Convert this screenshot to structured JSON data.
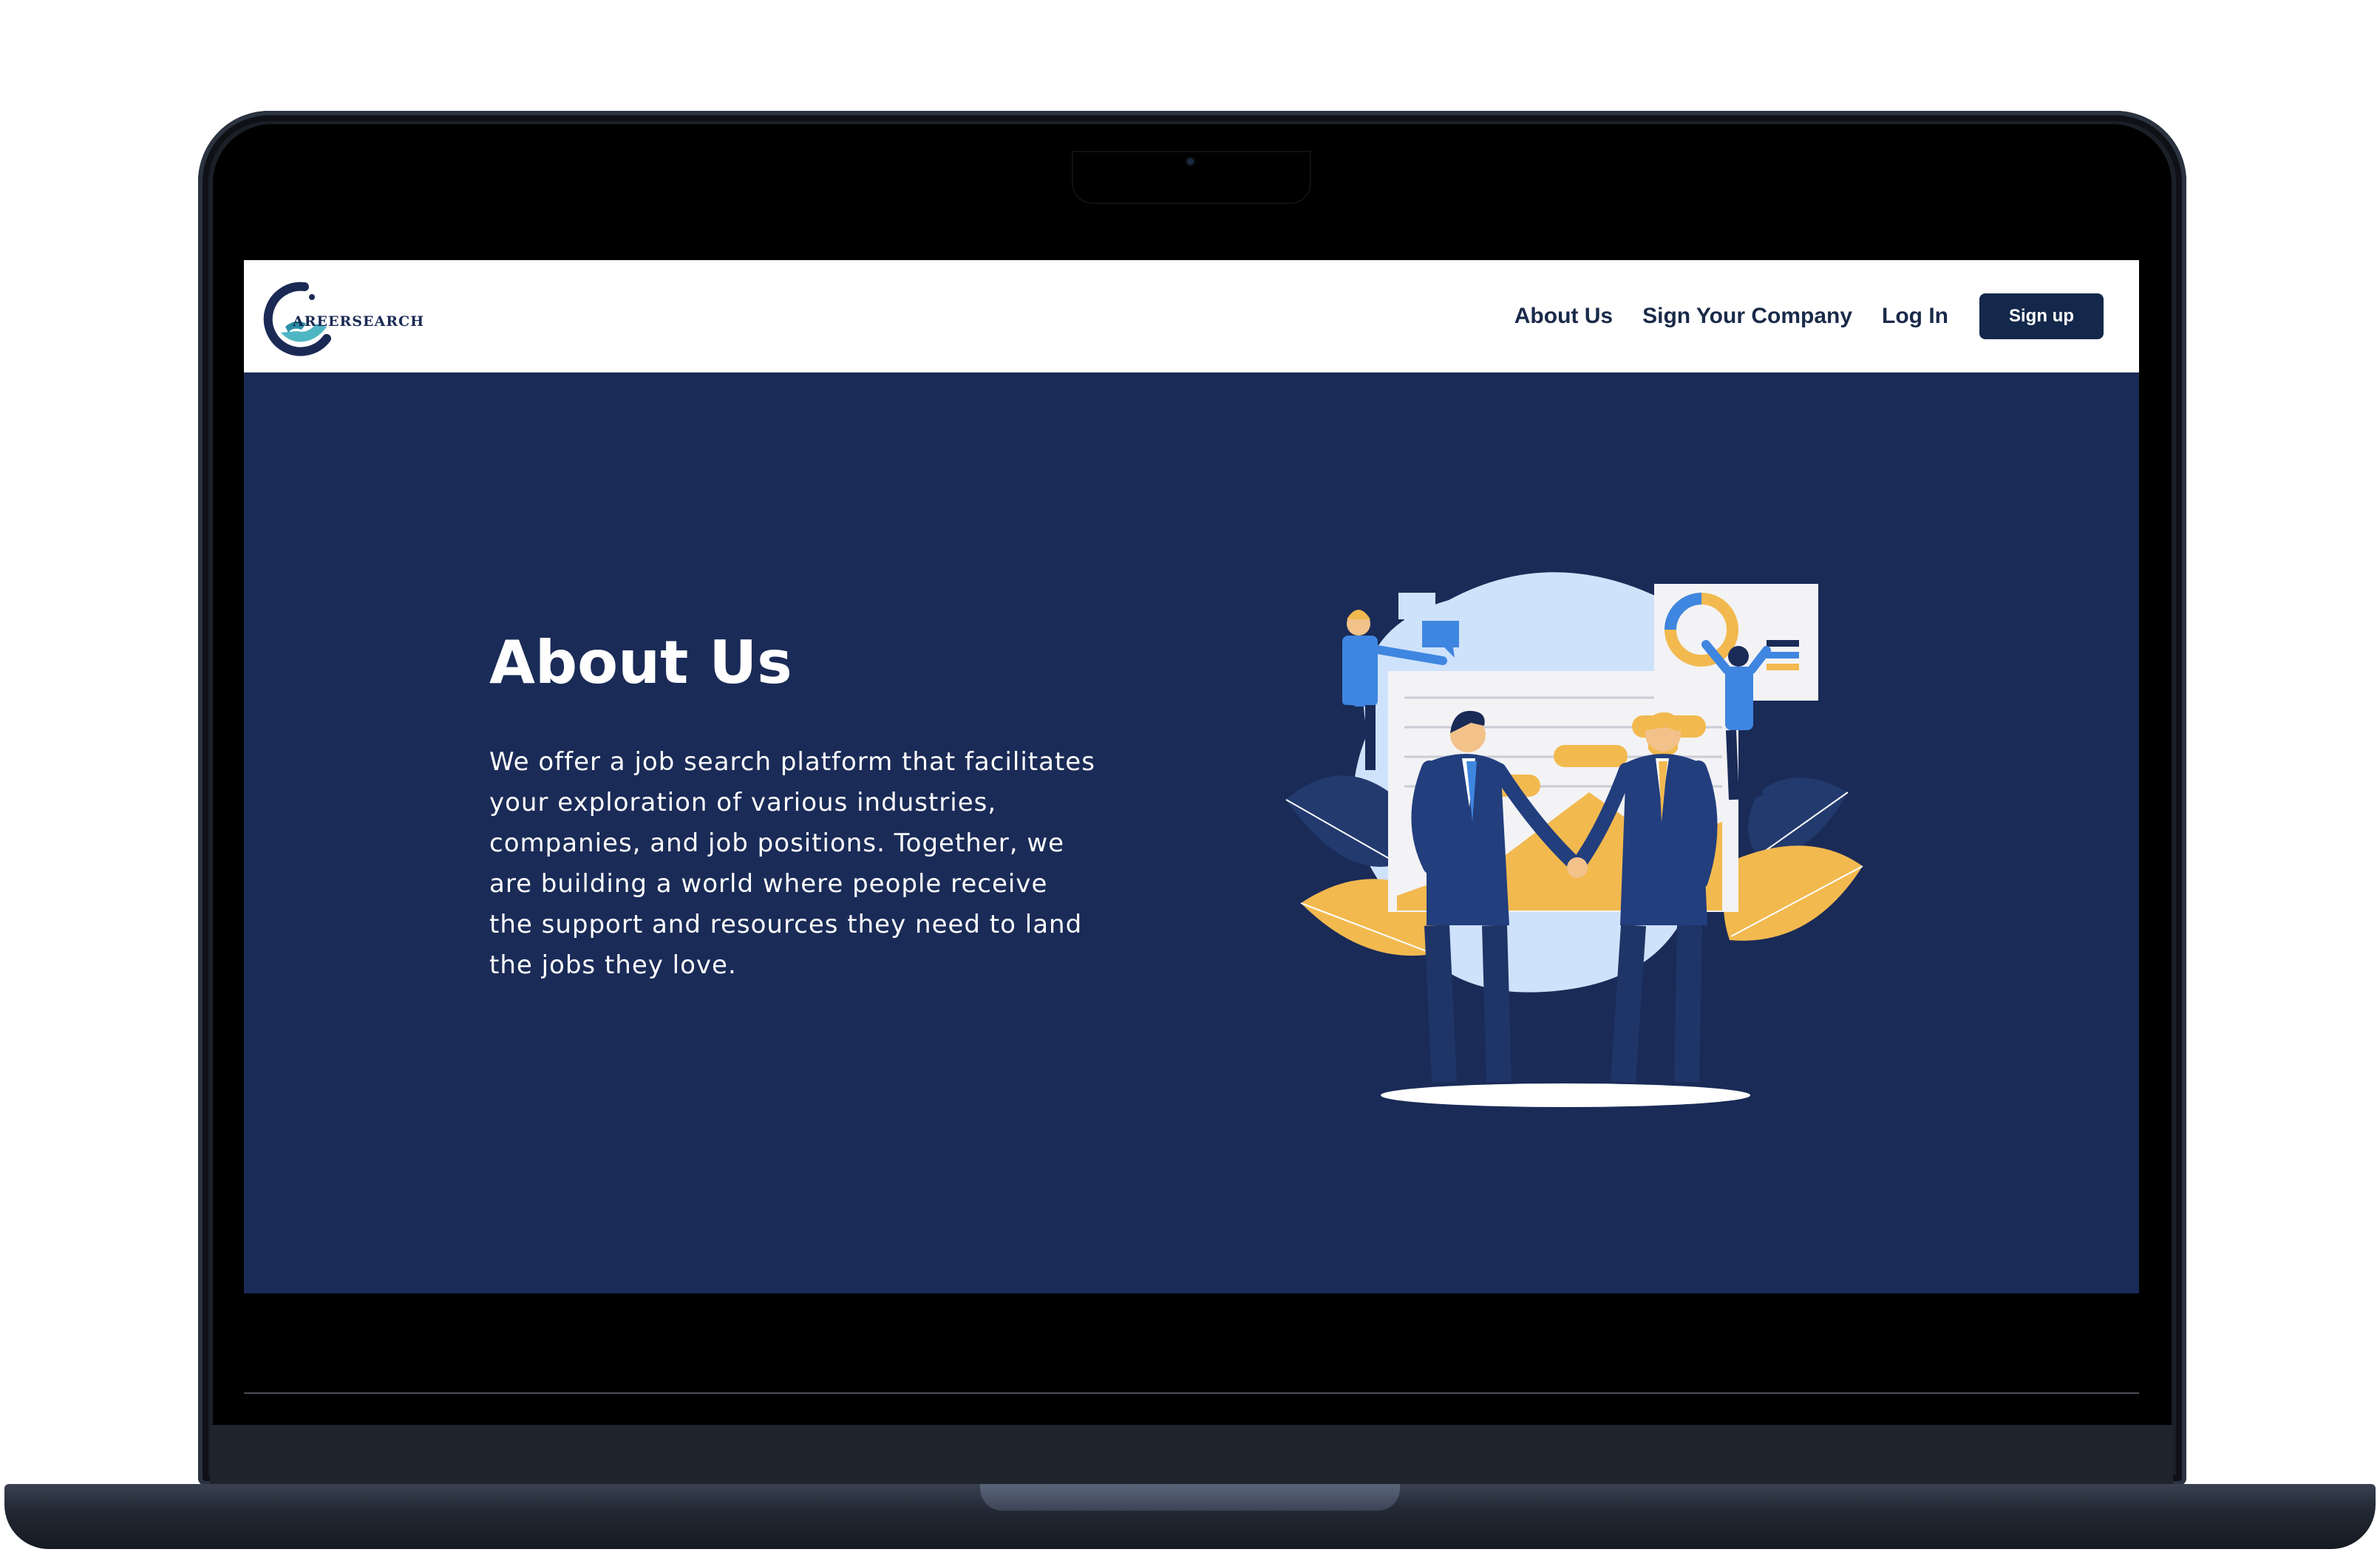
{
  "brand": {
    "logo_text": "AREERSEARCH"
  },
  "nav": {
    "links": [
      {
        "label": "About Us"
      },
      {
        "label": "Sign Your Company"
      },
      {
        "label": "Log In"
      }
    ],
    "signup_label": "Sign up"
  },
  "hero": {
    "title": "About Us",
    "description": "We offer a job search platform that facilitates your exploration of various industries, companies, and job positions. Together, we are building a world where people receive the support and resources they need to land the jobs they love."
  },
  "colors": {
    "navy": "#1a2b57",
    "button": "#13284a",
    "accent_yellow": "#f2b94f",
    "accent_blue": "#3f86e0",
    "light_blue": "#cfe2fb"
  }
}
